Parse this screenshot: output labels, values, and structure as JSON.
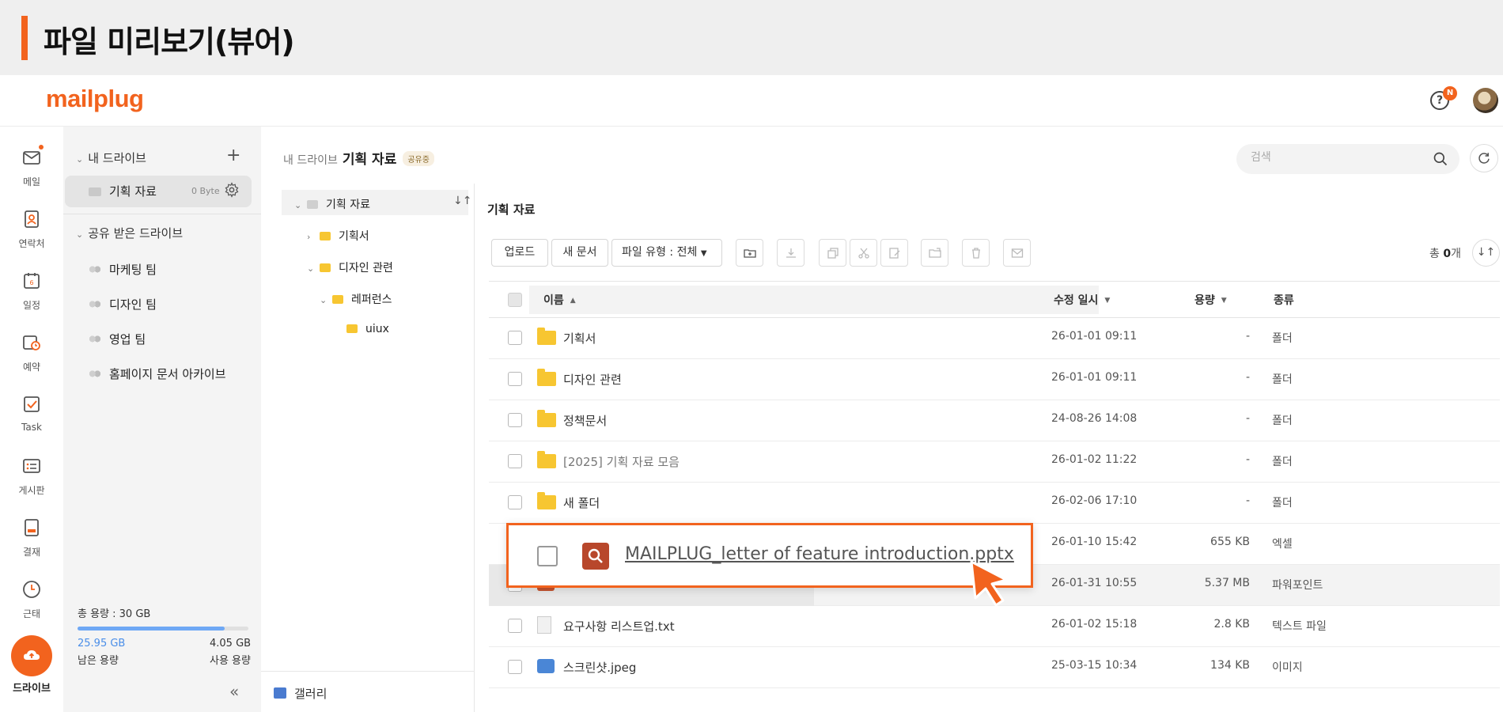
{
  "banner": {
    "title": "파일 미리보기(뷰어)"
  },
  "app": {
    "logo": "mailplug",
    "help_badge": "N",
    "accent": "#f2631e"
  },
  "rail": {
    "items": [
      {
        "label": "메일",
        "icon": "mail-icon"
      },
      {
        "label": "연락처",
        "icon": "contacts-icon"
      },
      {
        "label": "일정",
        "icon": "calendar-icon"
      },
      {
        "label": "예약",
        "icon": "reservation-icon"
      },
      {
        "label": "Task",
        "icon": "task-icon"
      },
      {
        "label": "게시판",
        "icon": "board-icon"
      },
      {
        "label": "결재",
        "icon": "approval-icon"
      },
      {
        "label": "근태",
        "icon": "attendance-icon"
      }
    ],
    "active": {
      "label": "드라이브",
      "icon": "drive-icon"
    }
  },
  "sidebar": {
    "my_drive": "내 드라이브",
    "my_drive_item": {
      "label": "기획 자료",
      "size": "0 Byte"
    },
    "shared_title": "공유 받은 드라이브",
    "shared_items": [
      "마케팅 팀",
      "디자인 팀",
      "영업 팀",
      "홈페이지 문서 아카이브"
    ],
    "storage": {
      "total": "총 용량 : 30 GB",
      "remaining": "25.95 GB",
      "used": "4.05 GB",
      "remaining_label": "남은 용량",
      "used_label": "사용 용량",
      "used_fraction": 0.86
    }
  },
  "breadcrumb": {
    "root": "내 드라이브",
    "current": "기획 자료",
    "badge": "공유중"
  },
  "search": {
    "placeholder": "검색"
  },
  "tree": {
    "root": "기획 자료",
    "items": [
      {
        "label": "기획서",
        "level": 1,
        "expanded": false
      },
      {
        "label": "디자인 관련",
        "level": 1,
        "expanded": true
      },
      {
        "label": "레퍼런스",
        "level": 2,
        "expanded": true
      },
      {
        "label": "uiux",
        "level": 3,
        "expanded": false
      }
    ],
    "gallery": "갤러리"
  },
  "main": {
    "title": "기획 자료",
    "toolbar": {
      "upload": "업로드",
      "new_doc": "새 문서",
      "file_type": "파일 유형 : 전체"
    },
    "total_prefix": "총 ",
    "total_count": "0",
    "total_suffix": "개",
    "columns": {
      "name": "이름",
      "modified": "수정 일시",
      "size": "용량",
      "type": "종류"
    },
    "rows": [
      {
        "name": "기획서",
        "date": "26-01-01 09:11",
        "size": "-",
        "type": "폴더",
        "kind": "folder"
      },
      {
        "name": "디자인 관련",
        "date": "26-01-01 09:11",
        "size": "-",
        "type": "폴더",
        "kind": "folder"
      },
      {
        "name": "정책문서",
        "date": "24-08-26 14:08",
        "size": "-",
        "type": "폴더",
        "kind": "folder"
      },
      {
        "name": "[2025] 기획 자료 모음",
        "date": "26-01-02 11:22",
        "size": "-",
        "type": "폴더",
        "kind": "folder"
      },
      {
        "name": "새 폴더",
        "date": "26-02-06 17:10",
        "size": "-",
        "type": "폴더",
        "kind": "folder"
      },
      {
        "name": "",
        "date": "26-01-10 15:42",
        "size": "655 KB",
        "type": "엑셀",
        "kind": "excel"
      },
      {
        "name": "",
        "date": "26-01-31 10:55",
        "size": "5.37 MB",
        "type": "파워포인트",
        "kind": "ppt"
      },
      {
        "name": "요구사항 리스트업.txt",
        "date": "26-01-02 15:18",
        "size": "2.8 KB",
        "type": "텍스트 파일",
        "kind": "text"
      },
      {
        "name": "스크린샷.jpeg",
        "date": "25-03-15 10:34",
        "size": "134 KB",
        "type": "이미지",
        "kind": "image"
      }
    ]
  },
  "callout": {
    "filename": "MAILPLUG_letter of feature introduction.pptx"
  }
}
